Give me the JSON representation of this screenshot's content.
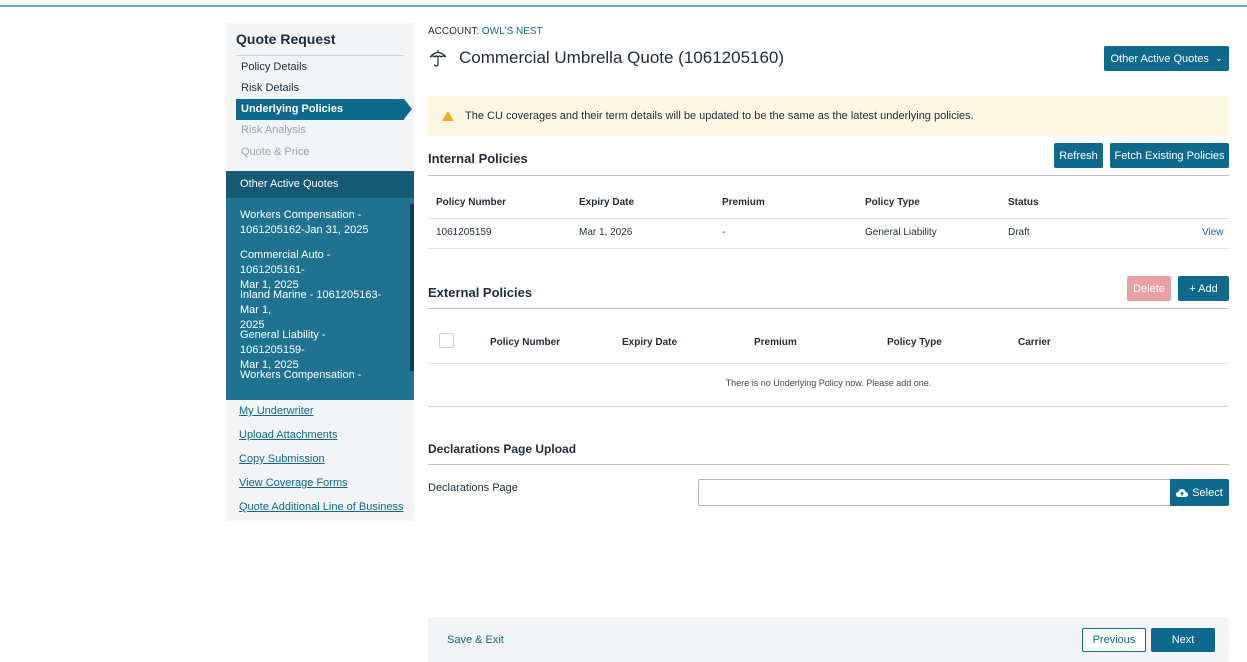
{
  "sidebar": {
    "title": "Quote Request",
    "steps": [
      {
        "label": "Policy Details",
        "state": "done"
      },
      {
        "label": "Risk Details",
        "state": "done"
      },
      {
        "label": "Underlying Policies",
        "state": "active"
      },
      {
        "label": "Risk Analysis",
        "state": "disabled"
      },
      {
        "label": "Quote & Price",
        "state": "disabled"
      }
    ],
    "other_active_quotes": {
      "heading": "Other Active Quotes",
      "items": [
        {
          "line1": "Workers Compensation -",
          "line2": "1061205162-Jan 31, 2025"
        },
        {
          "line1": "Commercial Auto - 1061205161-",
          "line2": "Mar 1, 2025"
        },
        {
          "line1": "Inland Marine - 1061205163-Mar 1,",
          "line2": "2025"
        },
        {
          "line1": "General Liability - 1061205159-",
          "line2": "Mar 1, 2025"
        },
        {
          "line1": "Workers Compensation -",
          "line2": ""
        }
      ]
    },
    "links": [
      "My Underwriter",
      "Upload Attachments",
      "Copy Submission",
      "View Coverage Forms",
      "Quote Additional Line of Business"
    ]
  },
  "header": {
    "account_label": "ACCOUNT:",
    "account_value": "OWL'S NEST",
    "title": "Commercial Umbrella Quote (1061205160)",
    "other_quotes_button": "Other Active Quotes",
    "icon": "umbrella-icon"
  },
  "alert": {
    "text": "The CU coverages and their term details will be updated to be the same as the latest underlying policies.",
    "color": "#f0ad1e"
  },
  "internal": {
    "title": "Internal Policies",
    "refresh_label": "Refresh",
    "fetch_label": "Fetch Existing Policies",
    "columns": [
      "Policy Number",
      "Expiry Date",
      "Premium",
      "Policy Type",
      "Status"
    ],
    "rows": [
      {
        "policy_number": "1061205159",
        "expiry_date": "Mar 1, 2026",
        "premium": "-",
        "policy_type": "General Liability",
        "status": "Draft",
        "action": "View"
      }
    ]
  },
  "external": {
    "title": "External Policies",
    "delete_label": "Delete",
    "add_label": "+ Add",
    "columns": [
      "Policy Number",
      "Expiry Date",
      "Premium",
      "Policy Type",
      "Carrier"
    ],
    "empty_message": "There is no Underlying Policy now. Please add one."
  },
  "declarations": {
    "title": "Declarations Page Upload",
    "field_label": "Declarations Page",
    "select_label": "Select"
  },
  "footer": {
    "save_exit": "Save & Exit",
    "previous": "Previous",
    "next": "Next"
  },
  "colors": {
    "primary": "#0e6a8d",
    "sidebar_panel": "#1f7391",
    "delete_disabled": "#e8a0a0",
    "alert_bg": "#fdf6e3"
  }
}
